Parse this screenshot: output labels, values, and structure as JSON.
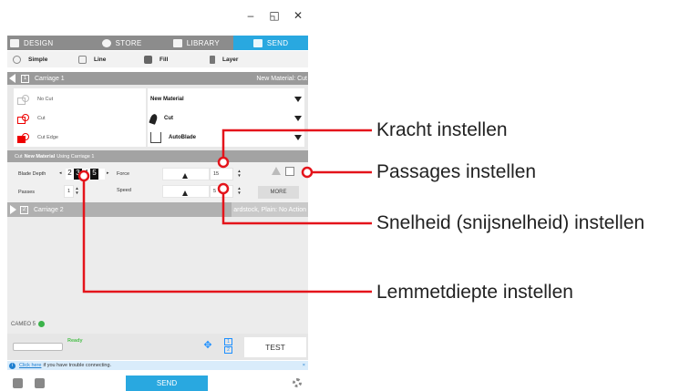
{
  "window": {
    "minimize": "–",
    "maximize": "◱",
    "close": "✕"
  },
  "nav": {
    "tabs": [
      {
        "label": "DESIGN"
      },
      {
        "label": "STORE"
      },
      {
        "label": "LIBRARY"
      },
      {
        "label": "SEND"
      }
    ]
  },
  "modes": {
    "items": [
      {
        "label": "Simple"
      },
      {
        "label": "Line"
      },
      {
        "label": "Fill"
      },
      {
        "label": "Layer"
      }
    ]
  },
  "carriage1": {
    "number": "1",
    "label": "Carriage 1",
    "material_summary": "New Material: Cut"
  },
  "cut_options": [
    {
      "label": "No Cut"
    },
    {
      "label": "Cut"
    },
    {
      "label": "Cut Edge"
    }
  ],
  "material": {
    "material": "New Material",
    "action": "Cut",
    "tool": "AutoBlade"
  },
  "settings": {
    "header_prefix": "Cut",
    "header_material": "New Material",
    "header_suffix": "Using Carriage 1",
    "blade_depth_label": "Blade Depth",
    "blade_depth_digits": [
      "2",
      "3",
      "4",
      "5"
    ],
    "passes_label": "Passes",
    "passes_value": "1",
    "force_label": "Force",
    "force_value": "15",
    "speed_label": "Speed",
    "speed_value": "5",
    "more_label": "MORE"
  },
  "carriage2": {
    "number": "2",
    "label": "Carriage 2",
    "material_summary": "ardstock, Plain: No Action"
  },
  "device": {
    "name": "CAMEO 5",
    "status": "Ready",
    "test_label": "TEST",
    "carriage_nums": [
      "1",
      "2"
    ]
  },
  "info": {
    "link": "Click here",
    "text": "if you have trouble connecting."
  },
  "footer": {
    "send_label": "SEND"
  },
  "callouts": {
    "force": "Kracht instellen",
    "passes": "Passages instellen",
    "speed": "Snelheid (snijsnelheid) instellen",
    "depth": "Lemmetdiepte instellen"
  },
  "colors": {
    "accent": "#29a8e0",
    "callout_line": "#e4141b",
    "ready": "#4bbf4b"
  }
}
